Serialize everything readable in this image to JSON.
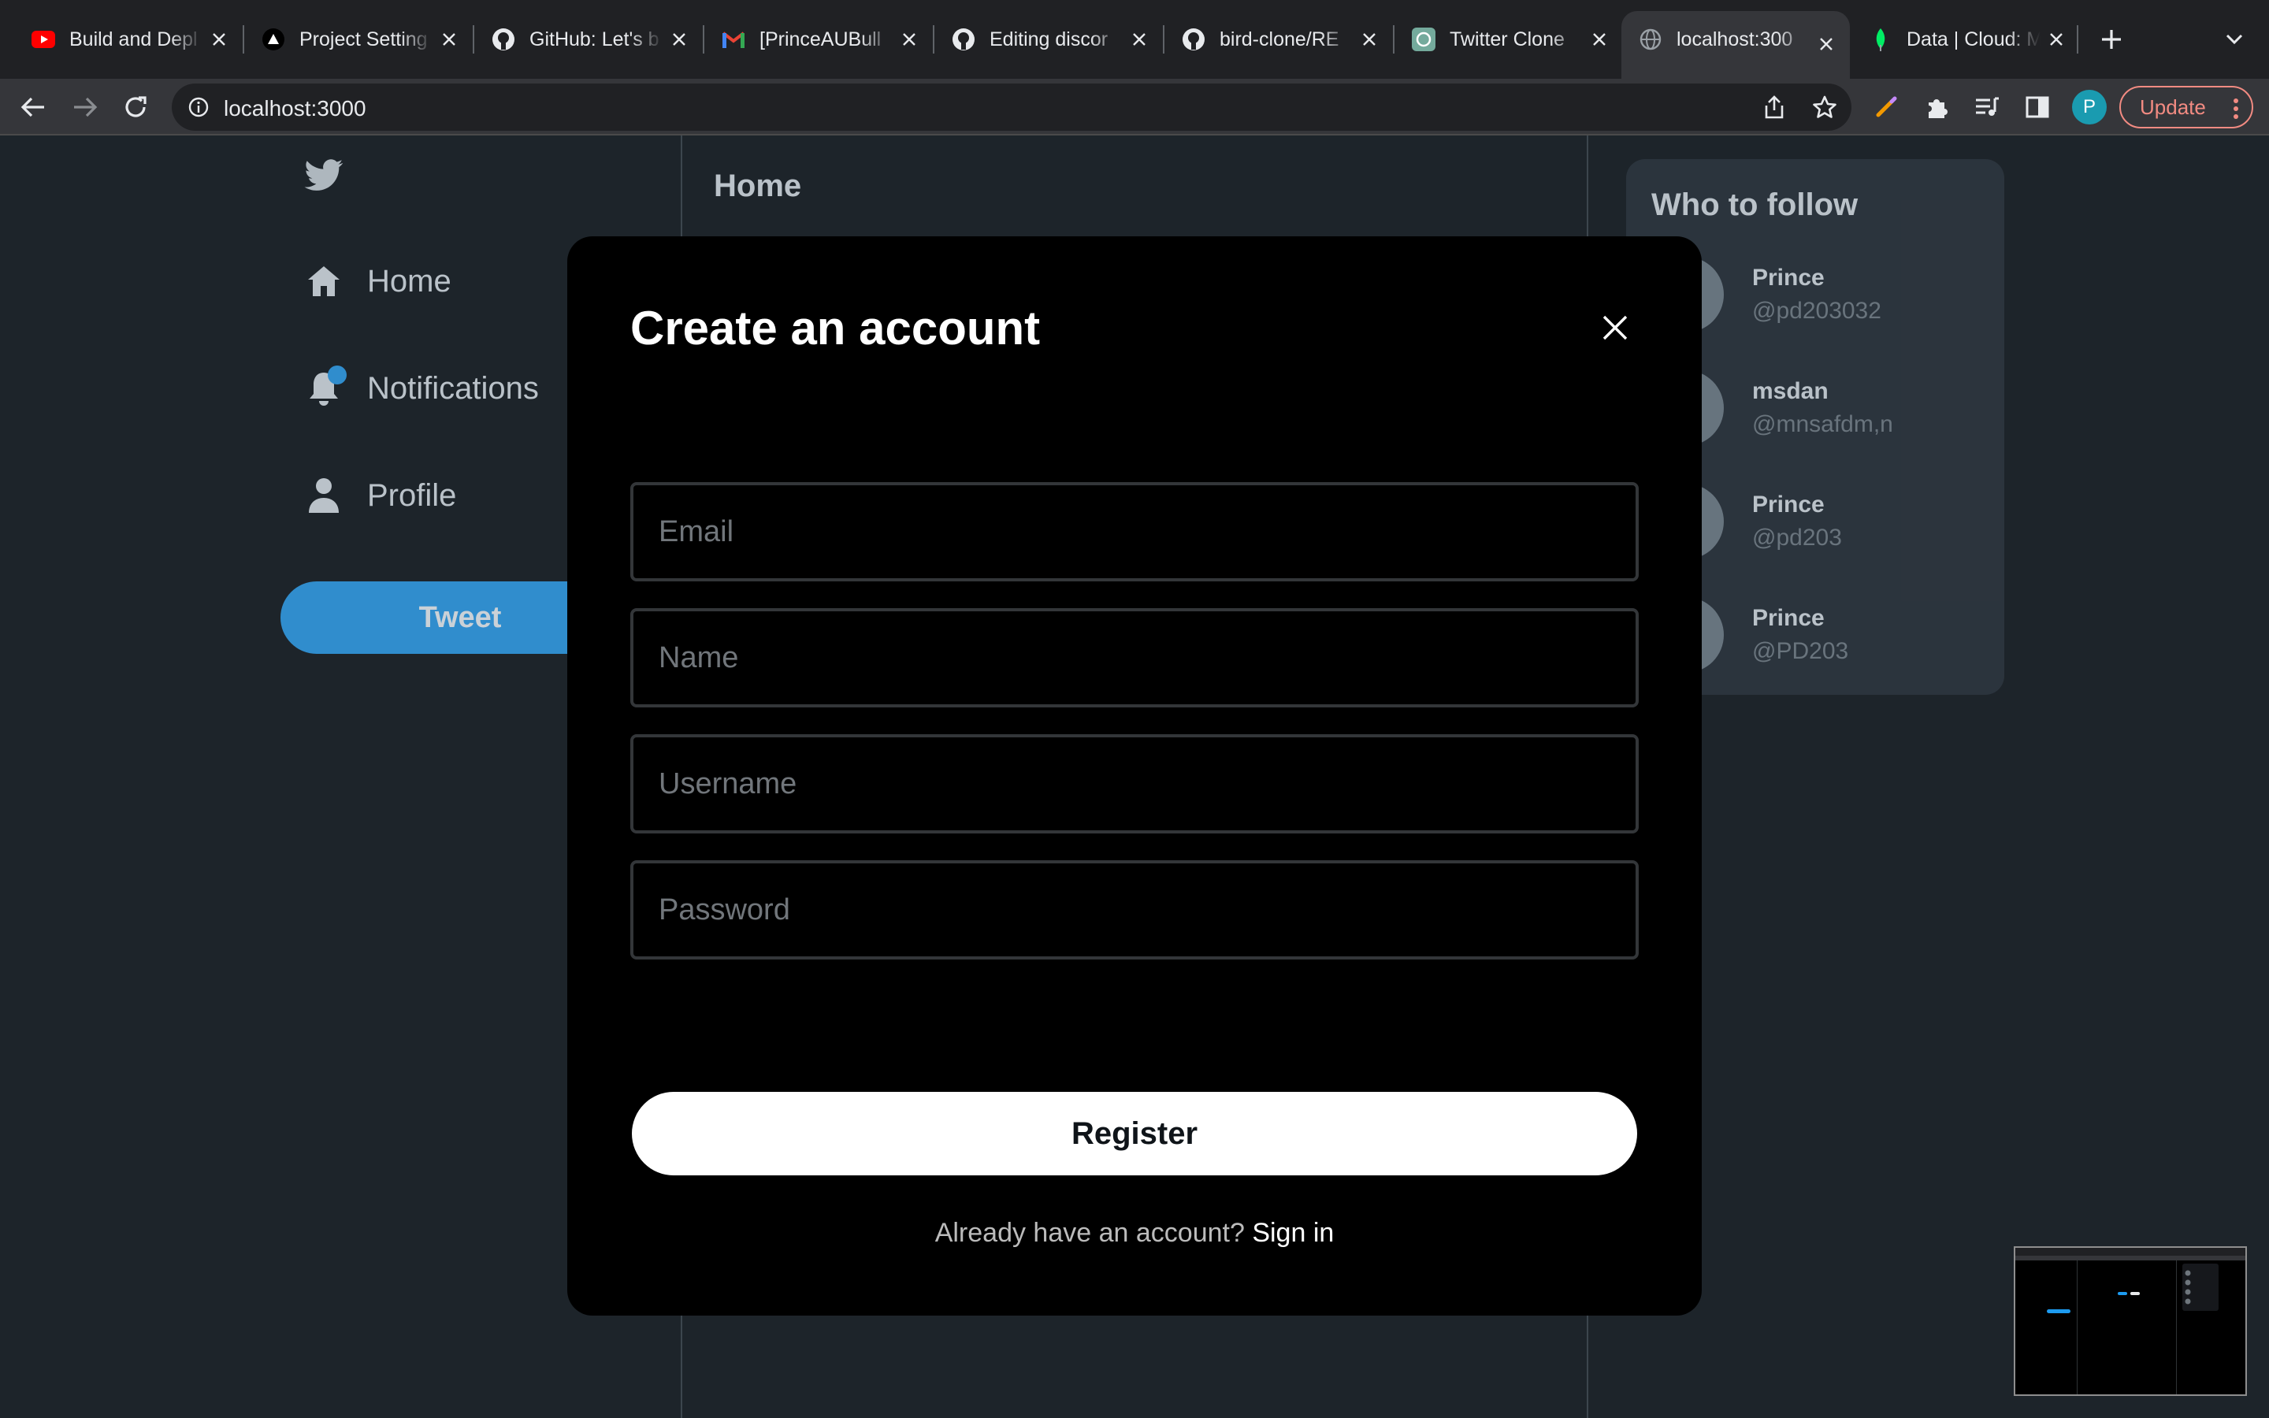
{
  "browser": {
    "tabs": [
      {
        "title": "Build and Depl",
        "favicon": "youtube-icon",
        "active": false
      },
      {
        "title": "Project Setting",
        "favicon": "vercel-icon",
        "active": false
      },
      {
        "title": "GitHub: Let's b",
        "favicon": "github-icon",
        "active": false
      },
      {
        "title": "[PrinceAUBull",
        "favicon": "gmail-icon",
        "active": false
      },
      {
        "title": "Editing discor",
        "favicon": "github-icon",
        "active": false
      },
      {
        "title": "bird-clone/RE",
        "favicon": "github-icon",
        "active": false
      },
      {
        "title": "Twitter Clone",
        "favicon": "openai-icon",
        "active": false
      },
      {
        "title": "localhost:300",
        "favicon": "globe-icon",
        "active": true
      },
      {
        "title": "Data | Cloud: M",
        "favicon": "mongodb-leaf-icon",
        "active": false
      }
    ],
    "address": "localhost:3000",
    "profile_initial": "P",
    "update_label": "Update"
  },
  "app": {
    "nav": {
      "home": "Home",
      "notifications": "Notifications",
      "profile": "Profile",
      "tweet_button": "Tweet"
    },
    "feed_title": "Home",
    "who_to_follow": {
      "title": "Who to follow",
      "users": [
        {
          "name": "Prince",
          "handle": "@pd203032"
        },
        {
          "name": "msdan",
          "handle": "@mnsafdm,n"
        },
        {
          "name": "Prince",
          "handle": "@pd203"
        },
        {
          "name": "Prince",
          "handle": "@PD203"
        }
      ]
    }
  },
  "modal": {
    "title": "Create an account",
    "fields": {
      "email": {
        "placeholder": "Email",
        "value": ""
      },
      "name": {
        "placeholder": "Name",
        "value": ""
      },
      "username": {
        "placeholder": "Username",
        "value": ""
      },
      "password": {
        "placeholder": "Password",
        "value": ""
      }
    },
    "register_label": "Register",
    "footer_question": "Already have an account?",
    "footer_link": "Sign in"
  },
  "colors": {
    "accent": "#1d9bf0",
    "modal_bg": "#000000",
    "update_outline": "#f28b82"
  }
}
